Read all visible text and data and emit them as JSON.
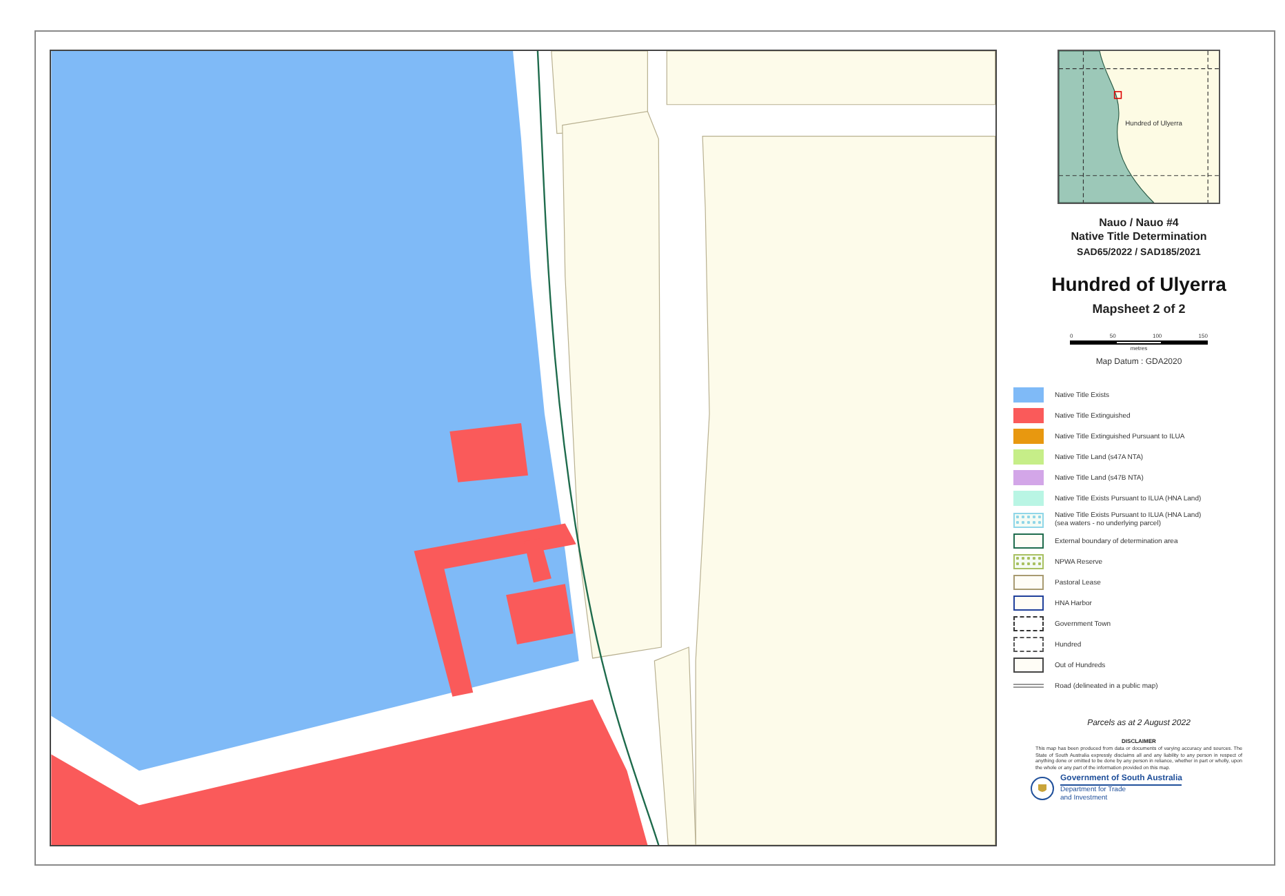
{
  "inset_map": {
    "label": "Hundred of Ulyerra"
  },
  "titles": {
    "project": "Nauo / Nauo #4",
    "determination": "Native Title Determination",
    "case_numbers": "SAD65/2022 / SAD185/2021",
    "hundred": "Hundred of Ulyerra",
    "mapsheet": "Mapsheet 2 of 2"
  },
  "scale_bar": {
    "ticks": [
      "0",
      "50",
      "100",
      "150"
    ],
    "unit": "metres"
  },
  "datum": "Map Datum : GDA2020",
  "legend": [
    {
      "kind": "fill",
      "color": "#7fbaf7",
      "label": "Native Title Exists"
    },
    {
      "kind": "fill",
      "color": "#fa5a5a",
      "label": "Native Title Extinguished"
    },
    {
      "kind": "fill",
      "color": "#e8980f",
      "label": "Native Title Extinguished Pursuant to ILUA"
    },
    {
      "kind": "fill",
      "color": "#c6ee88",
      "label": "Native Title Land (s47A NTA)"
    },
    {
      "kind": "fill",
      "color": "#d3a6e8",
      "label": "Native Title Land (s47B NTA)"
    },
    {
      "kind": "fill",
      "color": "#b9f5e4",
      "label": "Native Title Exists Pursuant to ILUA (HNA Land)"
    },
    {
      "kind": "pattern",
      "color": "#8fd6e8",
      "label": "Native Title Exists Pursuant to ILUA (HNA Land)\n(sea waters - no underlying parcel)"
    },
    {
      "kind": "outline",
      "color": "#1e6b4c",
      "label": "External boundary of determination area"
    },
    {
      "kind": "pattern",
      "color": "#a8c060",
      "label": "NPWA Reserve"
    },
    {
      "kind": "outline",
      "color": "#a89a70",
      "label": "Pastoral Lease"
    },
    {
      "kind": "outline",
      "color": "#1f3f9a",
      "label": "HNA Harbor"
    },
    {
      "kind": "dashed",
      "color": "#333333",
      "label": "Government Town"
    },
    {
      "kind": "dashed",
      "color": "#555555",
      "label": "Hundred"
    },
    {
      "kind": "outline",
      "color": "#444444",
      "label": "Out of Hundreds"
    },
    {
      "kind": "line",
      "color": "#999999",
      "label": "Road (delineated in a public map)"
    }
  ],
  "parcels_date": "Parcels as at 2 August 2022",
  "disclaimer": {
    "heading": "DISCLAIMER",
    "text": "This map has been produced from data or documents of varying accuracy and sources. The State of South Australia expressly disclaims all and any liability to any person in respect of anything done or omitted to be done by any person in reliance, whether in part or wholly, upon the whole or any part of the information provided on this map."
  },
  "logo": {
    "government": "Government of South Australia",
    "department": "Department for Trade",
    "department_line2": "and Investment"
  }
}
